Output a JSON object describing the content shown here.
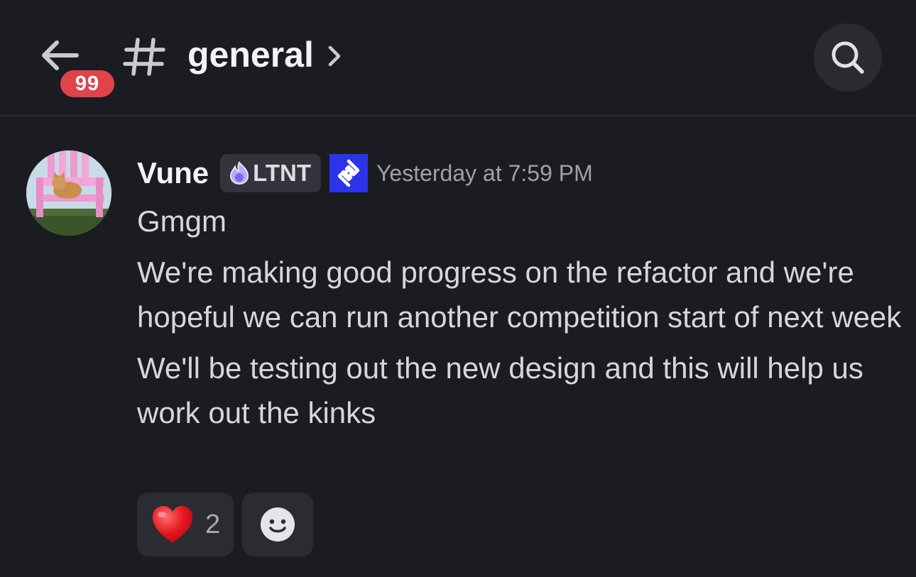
{
  "header": {
    "back_icon": "arrow-left-icon",
    "unread_count": "99",
    "channel_icon": "hash-icon",
    "channel_name": "general",
    "chevron_icon": "chevron-right-icon",
    "search_icon": "search-icon"
  },
  "message": {
    "author": "Vune",
    "tag_icon": "flame-icon",
    "tag": "LTNT",
    "app_badge_icon": "link-logo-icon",
    "timestamp": "Yesterday at 7:59 PM",
    "lines": [
      "Gmgm",
      "We're making good progress on the refactor and we're hopeful we can run another competition start of next week",
      "We'll be testing out the new design and this will help us work out the kinks"
    ],
    "reactions": [
      {
        "emoji": "❤️",
        "icon": "heart-emoji-icon",
        "count": "2"
      }
    ],
    "add_reaction_icon": "smiley-add-reaction-icon"
  },
  "colors": {
    "background": "#1b1c21",
    "badge_red": "#e0434b",
    "app_badge_blue": "#2b34e6",
    "tag_accent": "#9b8cf5"
  }
}
